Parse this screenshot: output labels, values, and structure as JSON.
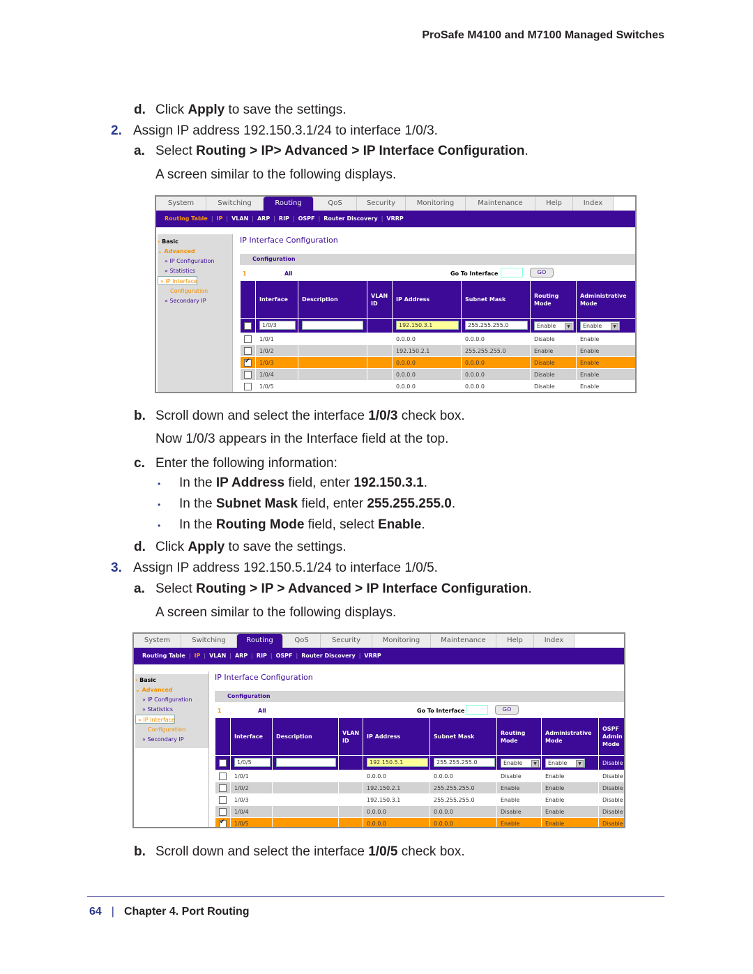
{
  "header": {
    "title": "ProSafe M4100 and M7100 Managed Switches"
  },
  "steps": {
    "d1": {
      "letter": "d.",
      "pre": "Click ",
      "bold": "Apply",
      "post": " to save the settings."
    },
    "s2": {
      "num": "2.",
      "text": "Assign IP address 192.150.3.1/24 to interface 1/0/3."
    },
    "s2a": {
      "letter": "a.",
      "pre": "Select ",
      "bold": "Routing > IP> Advanced > IP Interface Configuration",
      "post": "."
    },
    "s2a_note": "A screen similar to the following displays.",
    "s2b": {
      "letter": "b.",
      "pre": "Scroll down and select the interface ",
      "bold": "1/0/3",
      "post": " check box."
    },
    "s2b_note": "Now 1/0/3 appears in the Interface field at the top.",
    "s2c": {
      "letter": "c.",
      "text": "Enter the following information:"
    },
    "bullets": [
      {
        "pre": "In the ",
        "b1": "IP Address",
        "mid": " field, enter ",
        "b2": "192.150.3.1",
        "post": "."
      },
      {
        "pre": "In the ",
        "b1": "Subnet Mask",
        "mid": " field, enter ",
        "b2": "255.255.255.0",
        "post": "."
      },
      {
        "pre": "In the ",
        "b1": "Routing Mode",
        "mid": " field, select ",
        "b2": "Enable",
        "post": "."
      }
    ],
    "s2d": {
      "letter": "d.",
      "pre": "Click ",
      "bold": "Apply",
      "post": " to save the settings."
    },
    "s3": {
      "num": "3.",
      "text": "Assign IP address 192.150.5.1/24 to interface 1/0/5."
    },
    "s3a": {
      "letter": "a.",
      "pre": "Select ",
      "bold": "Routing > IP > Advanced > IP Interface Configuration",
      "post": "."
    },
    "s3a_note": "A screen similar to the following displays.",
    "s3b": {
      "letter": "b.",
      "pre": "Scroll down and select the interface ",
      "bold": "1/0/5",
      "post": " check box."
    }
  },
  "ui": {
    "tabs": [
      "System",
      "Switching",
      "Routing",
      "QoS",
      "Security",
      "Monitoring",
      "Maintenance",
      "Help",
      "Index"
    ],
    "active_tab": "Routing",
    "subnav": [
      "Routing Table",
      "IP",
      "VLAN",
      "ARP",
      "RIP",
      "OSPF",
      "Router Discovery",
      "VRRP"
    ],
    "sidebar": {
      "basic": "Basic",
      "advanced": "Advanced",
      "items": [
        "» IP Configuration",
        "» Statistics",
        "» IP Interface",
        "Configuration",
        "» Secondary IP"
      ]
    },
    "page_title": "IP Interface Configuration",
    "config_label": "Configuration",
    "page_num": "1",
    "all_label": "All",
    "goto_label": "Go To Interface",
    "go_button": "GO",
    "enable_label": "Enable"
  },
  "screen1": {
    "columns": [
      "Interface",
      "Description",
      "VLAN ID",
      "IP Address",
      "Subnet Mask",
      "Routing Mode",
      "Administrative Mode"
    ],
    "edit_row": {
      "interface": "1/0/3",
      "description": "",
      "ip": "192.150.3.1",
      "mask": "255.255.255.0",
      "routing": "Enable",
      "admin": "Enable"
    },
    "rows": [
      {
        "checked": false,
        "interface": "1/0/1",
        "ip": "0.0.0.0",
        "mask": "0.0.0.0",
        "routing": "Disable",
        "admin": "Enable",
        "style": "w"
      },
      {
        "checked": false,
        "interface": "1/0/2",
        "ip": "192.150.2.1",
        "mask": "255.255.255.0",
        "routing": "Enable",
        "admin": "Enable",
        "style": "g"
      },
      {
        "checked": true,
        "interface": "1/0/3",
        "ip": "0.0.0.0",
        "mask": "0.0.0.0",
        "routing": "Disable",
        "admin": "Enable",
        "style": "o"
      },
      {
        "checked": false,
        "interface": "1/0/4",
        "ip": "0.0.0.0",
        "mask": "0.0.0.0",
        "routing": "Disable",
        "admin": "Enable",
        "style": "g"
      },
      {
        "checked": false,
        "interface": "1/0/5",
        "ip": "0.0.0.0",
        "mask": "0.0.0.0",
        "routing": "Disable",
        "admin": "Enable",
        "style": "w"
      }
    ]
  },
  "screen2": {
    "columns": [
      "Interface",
      "Description",
      "VLAN ID",
      "IP Address",
      "Subnet Mask",
      "Routing Mode",
      "Administrative Mode",
      "OSPF Admin Mode"
    ],
    "edit_row": {
      "interface": "1/0/5",
      "description": "",
      "ip": "192.150.5.1",
      "mask": "255.255.255.0",
      "routing": "Enable",
      "admin": "Enable",
      "ospf": "Disable"
    },
    "rows": [
      {
        "checked": false,
        "interface": "1/0/1",
        "ip": "0.0.0.0",
        "mask": "0.0.0.0",
        "routing": "Disable",
        "admin": "Enable",
        "ospf": "Disable",
        "style": "w"
      },
      {
        "checked": false,
        "interface": "1/0/2",
        "ip": "192.150.2.1",
        "mask": "255.255.255.0",
        "routing": "Enable",
        "admin": "Enable",
        "ospf": "Disable",
        "style": "g"
      },
      {
        "checked": false,
        "interface": "1/0/3",
        "ip": "192.150.3.1",
        "mask": "255.255.255.0",
        "routing": "Enable",
        "admin": "Enable",
        "ospf": "Disable",
        "style": "w"
      },
      {
        "checked": false,
        "interface": "1/0/4",
        "ip": "0.0.0.0",
        "mask": "0.0.0.0",
        "routing": "Disable",
        "admin": "Enable",
        "ospf": "Disable",
        "style": "g"
      },
      {
        "checked": true,
        "interface": "1/0/5",
        "ip": "0.0.0.0",
        "mask": "0.0.0.0",
        "routing": "Enable",
        "admin": "Enable",
        "ospf": "Disable",
        "style": "o"
      }
    ]
  },
  "footer": {
    "page": "64",
    "chapter": "Chapter 4.  Port Routing"
  }
}
